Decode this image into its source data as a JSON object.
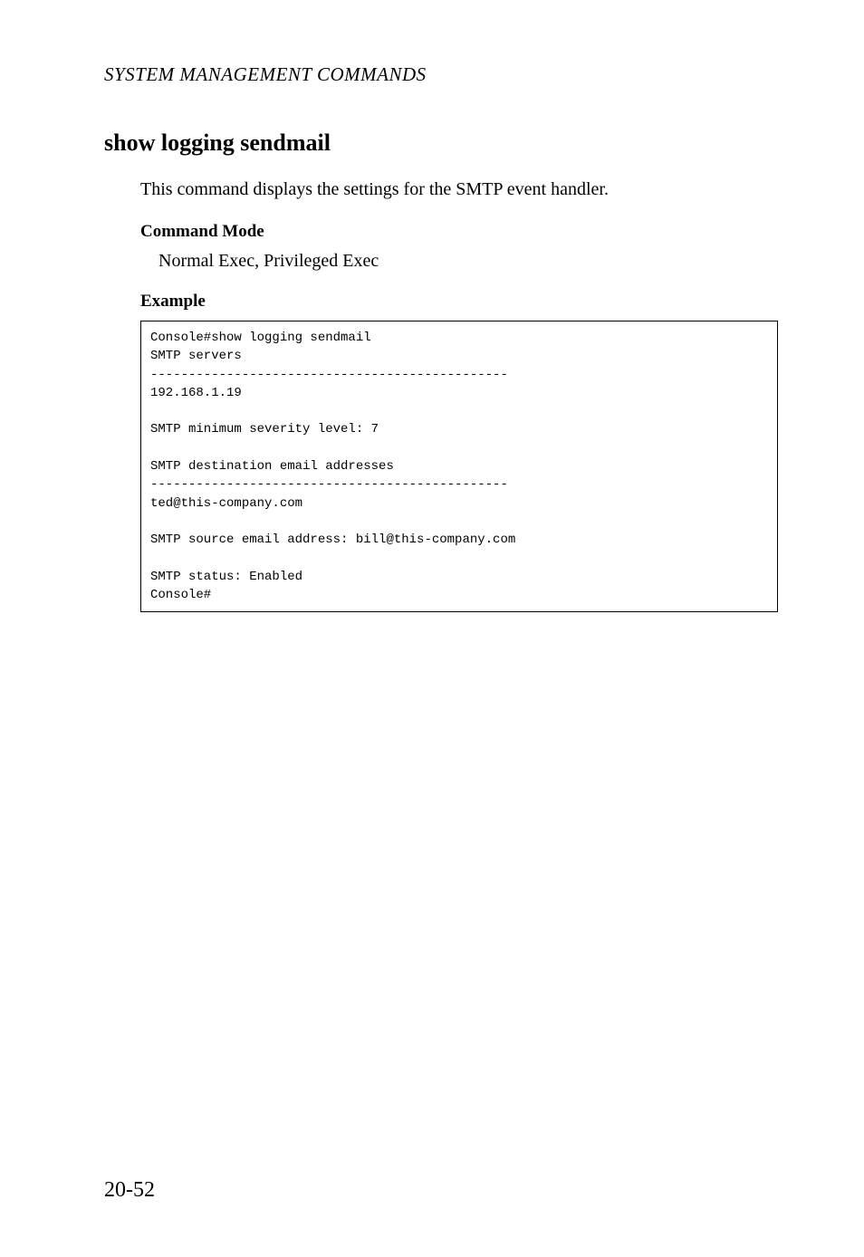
{
  "header": {
    "running_title": "SYSTEM MANAGEMENT COMMANDS"
  },
  "section": {
    "title": "show logging sendmail",
    "description": "This command displays the settings for the SMTP event handler.",
    "command_mode": {
      "label": "Command Mode",
      "text": "Normal Exec, Privileged Exec"
    },
    "example": {
      "label": "Example",
      "code": "Console#show logging sendmail\nSMTP servers\n-----------------------------------------------\n192.168.1.19\n\nSMTP minimum severity level: 7\n\nSMTP destination email addresses\n-----------------------------------------------\nted@this-company.com\n\nSMTP source email address: bill@this-company.com\n\nSMTP status: Enabled\nConsole#"
    }
  },
  "footer": {
    "page_number": "20-52"
  }
}
